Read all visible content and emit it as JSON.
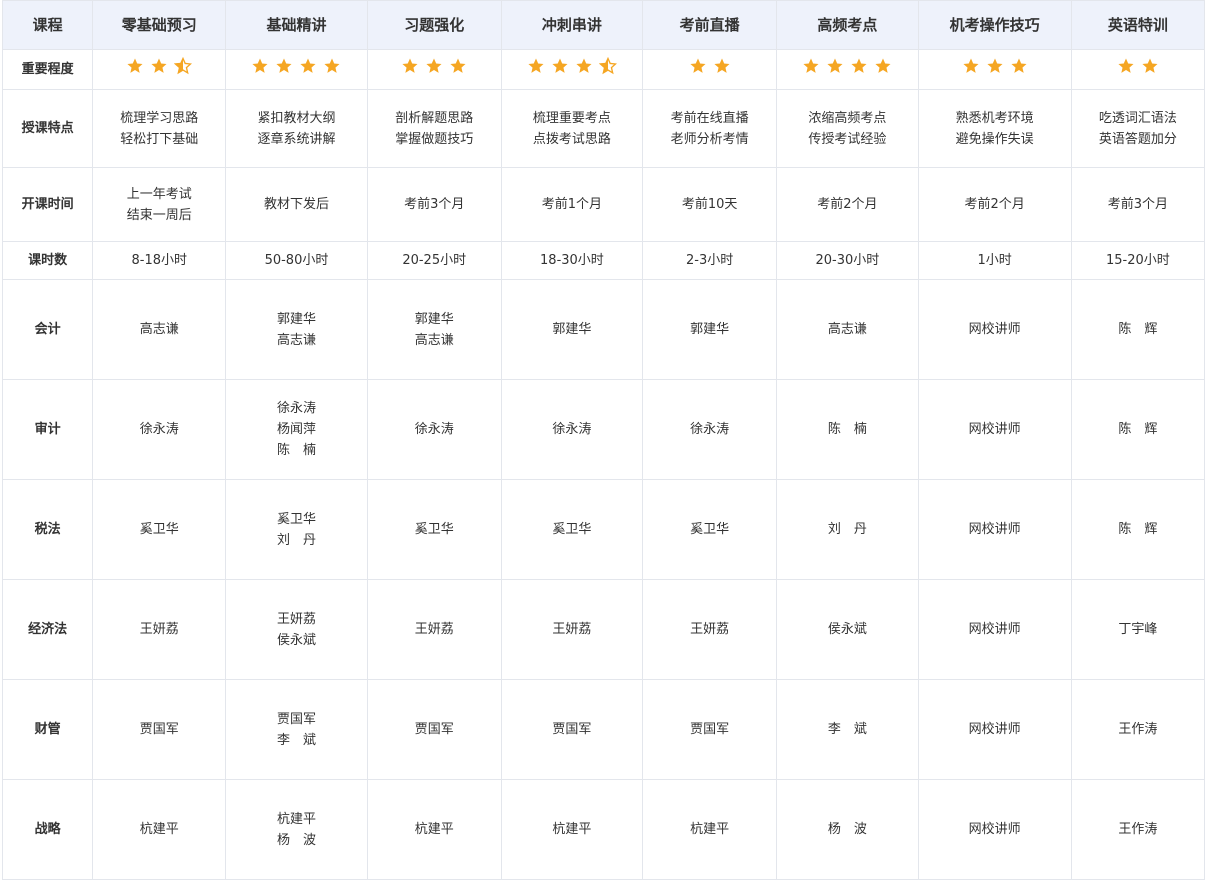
{
  "columns": [
    "课程",
    "零基础预习",
    "基础精讲",
    "习题强化",
    "冲刺串讲",
    "考前直播",
    "高频考点",
    "机考操作技巧",
    "英语特训"
  ],
  "colors": {
    "star": "#f5a623",
    "header_bg": "#eef2fb",
    "border": "#e3e6ec"
  },
  "importance": {
    "label": "重要程度",
    "values": [
      2.5,
      4,
      3,
      3.5,
      2,
      4,
      3,
      2
    ]
  },
  "rows": [
    {
      "label": "授课特点",
      "height": 78,
      "cells": [
        [
          "梳理学习思路",
          "轻松打下基础"
        ],
        [
          "紧扣教材大纲",
          "逐章系统讲解"
        ],
        [
          "剖析解题思路",
          "掌握做题技巧"
        ],
        [
          "梳理重要考点",
          "点拨考试思路"
        ],
        [
          "考前在线直播",
          "老师分析考情"
        ],
        [
          "浓缩高频考点",
          "传授考试经验"
        ],
        [
          "熟悉机考环境",
          "避免操作失误"
        ],
        [
          "吃透词汇语法",
          "英语答题加分"
        ]
      ]
    },
    {
      "label": "开课时间",
      "height": 74,
      "cells": [
        [
          "上一年考试",
          "结束一周后"
        ],
        [
          "教材下发后"
        ],
        [
          "考前3个月"
        ],
        [
          "考前1个月"
        ],
        [
          "考前10天"
        ],
        [
          "考前2个月"
        ],
        [
          "考前2个月"
        ],
        [
          "考前3个月"
        ]
      ]
    },
    {
      "label": "课时数",
      "height": 38,
      "cells": [
        [
          "8-18小时"
        ],
        [
          "50-80小时"
        ],
        [
          "20-25小时"
        ],
        [
          "18-30小时"
        ],
        [
          "2-3小时"
        ],
        [
          "20-30小时"
        ],
        [
          "1小时"
        ],
        [
          "15-20小时"
        ]
      ]
    },
    {
      "label": "会计",
      "height": 100,
      "cells": [
        [
          "高志谦"
        ],
        [
          "郭建华",
          "高志谦"
        ],
        [
          "郭建华",
          "高志谦"
        ],
        [
          "郭建华"
        ],
        [
          "郭建华"
        ],
        [
          "高志谦"
        ],
        [
          "网校讲师"
        ],
        [
          "陈　辉"
        ]
      ]
    },
    {
      "label": "审计",
      "height": 100,
      "cells": [
        [
          "徐永涛"
        ],
        [
          "徐永涛",
          "杨闻萍",
          "陈　楠"
        ],
        [
          "徐永涛"
        ],
        [
          "徐永涛"
        ],
        [
          "徐永涛"
        ],
        [
          "陈　楠"
        ],
        [
          "网校讲师"
        ],
        [
          "陈　辉"
        ]
      ]
    },
    {
      "label": "税法",
      "height": 100,
      "cells": [
        [
          "奚卫华"
        ],
        [
          "奚卫华",
          "刘　丹"
        ],
        [
          "奚卫华"
        ],
        [
          "奚卫华"
        ],
        [
          "奚卫华"
        ],
        [
          "刘　丹"
        ],
        [
          "网校讲师"
        ],
        [
          "陈　辉"
        ]
      ]
    },
    {
      "label": "经济法",
      "height": 100,
      "cells": [
        [
          "王妍荔"
        ],
        [
          "王妍荔",
          "侯永斌"
        ],
        [
          "王妍荔"
        ],
        [
          "王妍荔"
        ],
        [
          "王妍荔"
        ],
        [
          "侯永斌"
        ],
        [
          "网校讲师"
        ],
        [
          "丁宇峰"
        ]
      ]
    },
    {
      "label": "财管",
      "height": 100,
      "cells": [
        [
          "贾国军"
        ],
        [
          "贾国军",
          "李　斌"
        ],
        [
          "贾国军"
        ],
        [
          "贾国军"
        ],
        [
          "贾国军"
        ],
        [
          "李　斌"
        ],
        [
          "网校讲师"
        ],
        [
          "王作涛"
        ]
      ]
    },
    {
      "label": "战略",
      "height": 100,
      "cells": [
        [
          "杭建平"
        ],
        [
          "杭建平",
          "杨　波"
        ],
        [
          "杭建平"
        ],
        [
          "杭建平"
        ],
        [
          "杭建平"
        ],
        [
          "杨　波"
        ],
        [
          "网校讲师"
        ],
        [
          "王作涛"
        ]
      ]
    }
  ]
}
